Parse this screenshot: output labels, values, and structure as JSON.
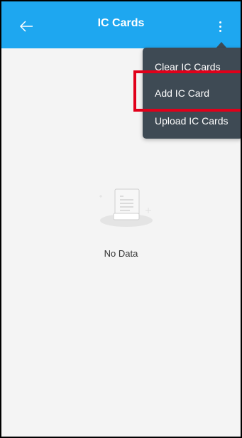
{
  "header": {
    "title": "IC Cards",
    "back_icon": "back-arrow-icon",
    "more_icon": "more-vertical-icon",
    "background": "#1ea7f0"
  },
  "menu": {
    "items": [
      {
        "label": "Clear IC Cards"
      },
      {
        "label": "Add IC Card"
      },
      {
        "label": "Upload IC Cards"
      }
    ],
    "highlighted": "Add IC Card",
    "highlight_color": "#e1001a"
  },
  "empty_state": {
    "icon": "empty-document-icon",
    "text": "No Data"
  }
}
